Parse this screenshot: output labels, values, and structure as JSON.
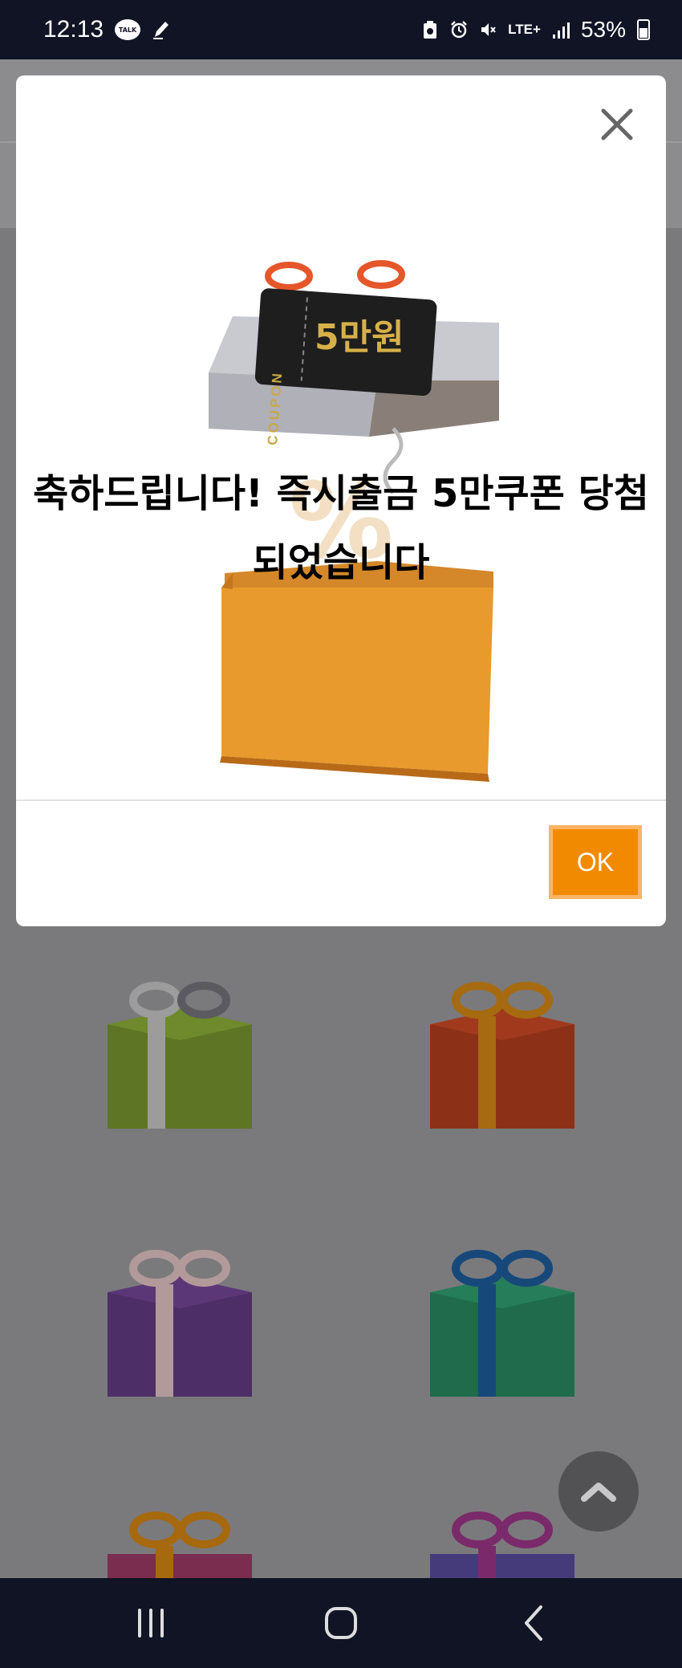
{
  "status_bar": {
    "time": "12:13",
    "talk_badge": "TALK",
    "network": "LTE+",
    "battery": "53%"
  },
  "modal": {
    "coupon_word": "COUPON",
    "coupon_amount": "5만원",
    "message_line1": "축하드립니다! 즉시출금 5만쿠폰 당첨",
    "message_line2": "되었습니다",
    "ok_label": "OK"
  },
  "colors": {
    "accent": "#f28a00",
    "ok_border": "#fbb565",
    "system_bar": "#101424",
    "overlay": "#7a7a7d"
  },
  "icons": [
    "talk-icon",
    "pen-icon",
    "clipboard-icon",
    "alarm-icon",
    "mute-icon",
    "signal-icon",
    "battery-icon",
    "close-icon",
    "chevron-up-icon",
    "recent-apps-icon",
    "home-icon",
    "back-icon"
  ]
}
